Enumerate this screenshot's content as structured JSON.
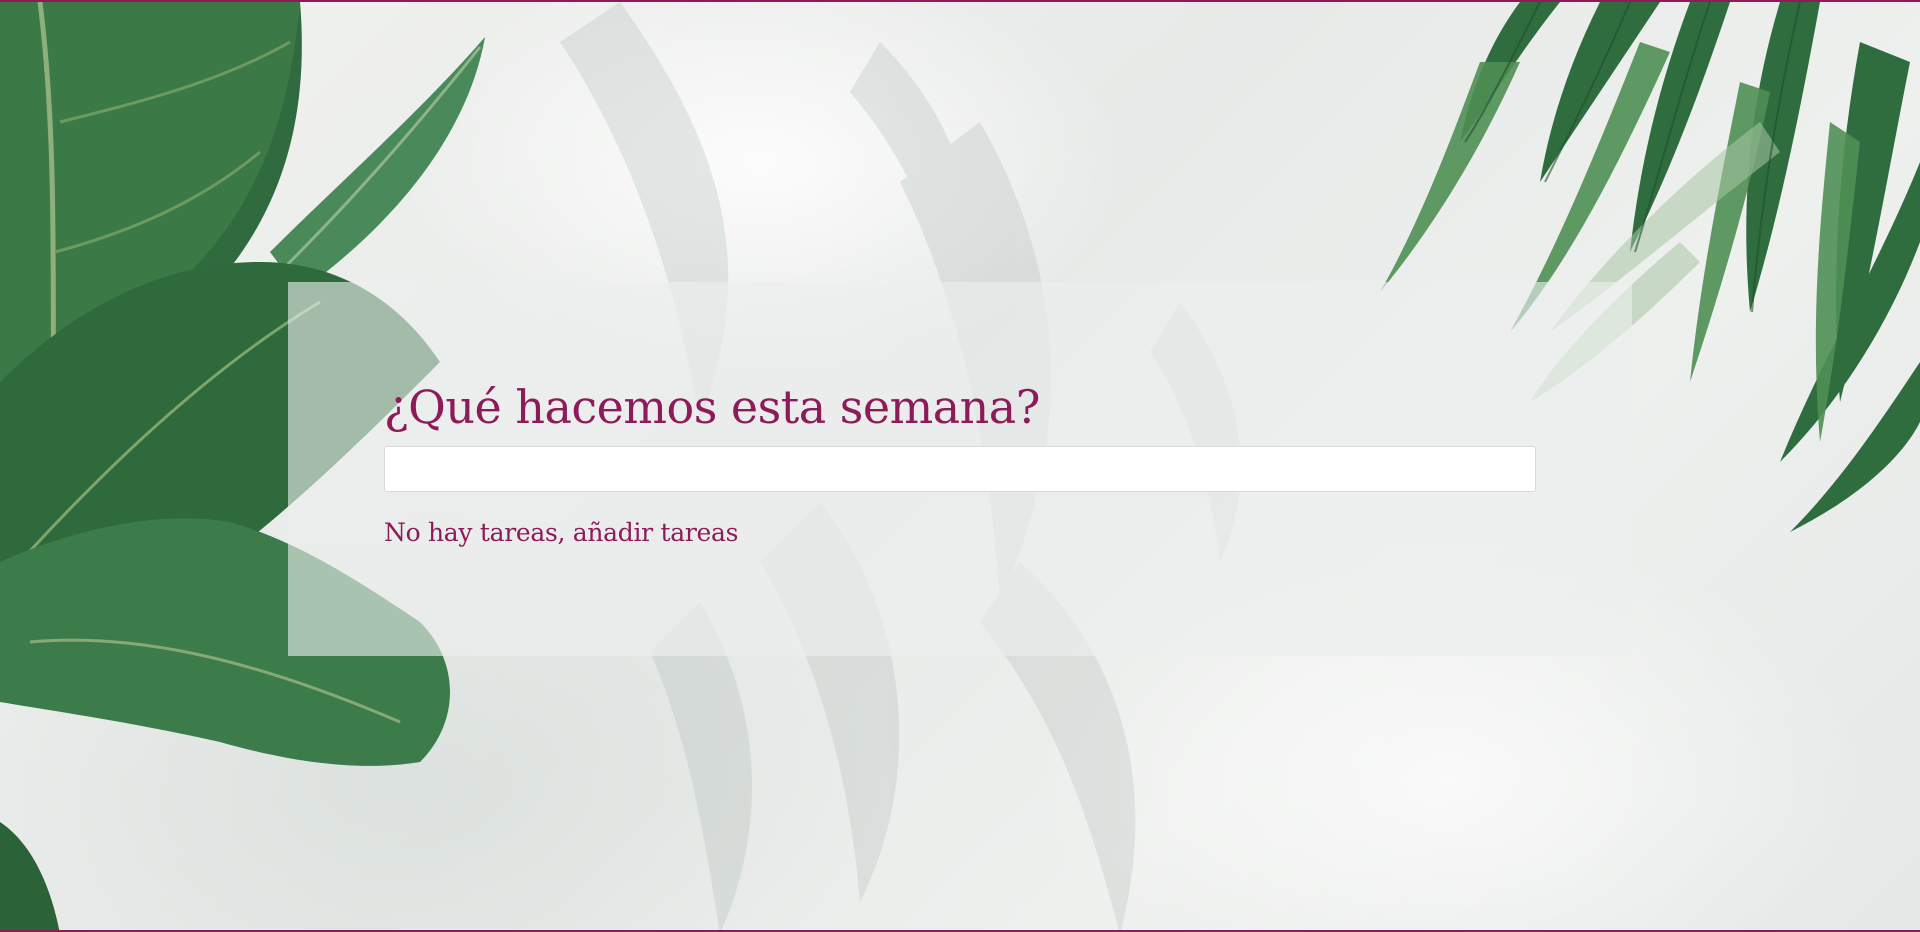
{
  "app": {
    "title": "¿Qué hacemos esta semana?",
    "task_input": {
      "value": "",
      "placeholder": ""
    },
    "empty_state": "No hay tareas, añadir tareas"
  },
  "theme": {
    "accent": "#8d1b5a",
    "card_background": "rgba(236,239,238,0.62)",
    "input_background": "#ffffff",
    "foliage_dark": "#2f6b3e",
    "foliage_light": "#4f8f55"
  },
  "background": {
    "description_icon_left": "fiddle-leaf-plant",
    "description_icon_right": "palm-fronds"
  }
}
